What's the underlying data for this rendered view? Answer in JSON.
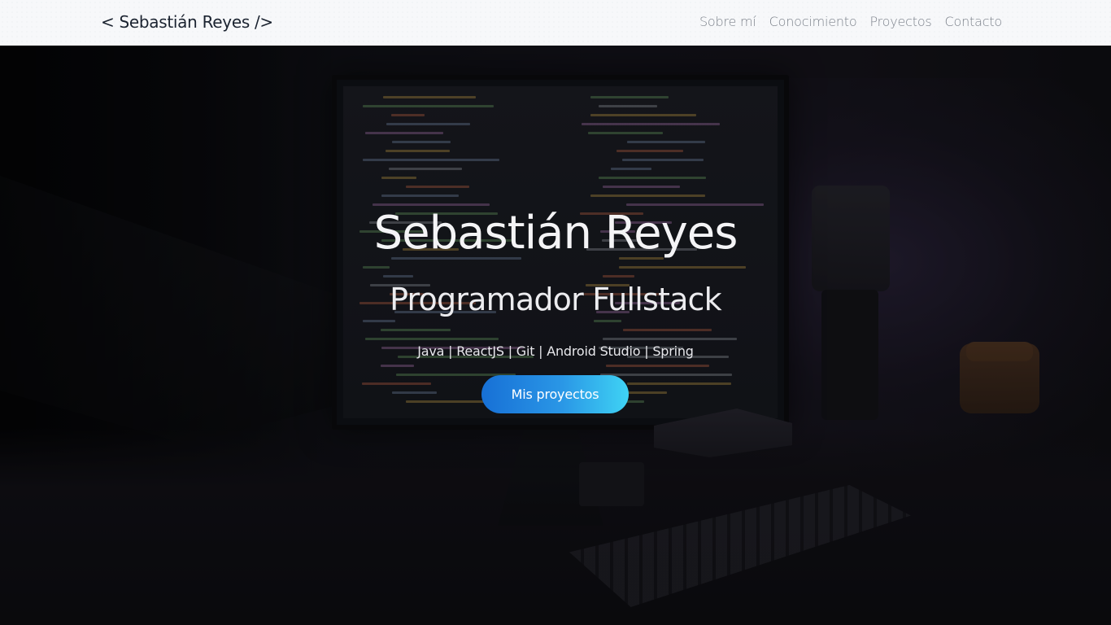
{
  "navbar": {
    "brand": "< Sebastián Reyes />",
    "links": [
      "Sobre mí",
      "Conocimiento",
      "Proyectos",
      "Contacto"
    ]
  },
  "hero": {
    "title": "Sebastián Reyes",
    "subtitle": "Programador Fullstack",
    "skills": "Java | ReactJS | Git | Android Studio | Spring",
    "cta_label": "Mis proyectos"
  },
  "colors": {
    "navbar_bg": "#f7f8fa",
    "brand_text": "#1b2330",
    "nav_link_text": "#7d838c",
    "hero_text": "#f4f4f6",
    "cta_gradient_start": "#1770d6",
    "cta_gradient_end": "#3fd3f4"
  }
}
